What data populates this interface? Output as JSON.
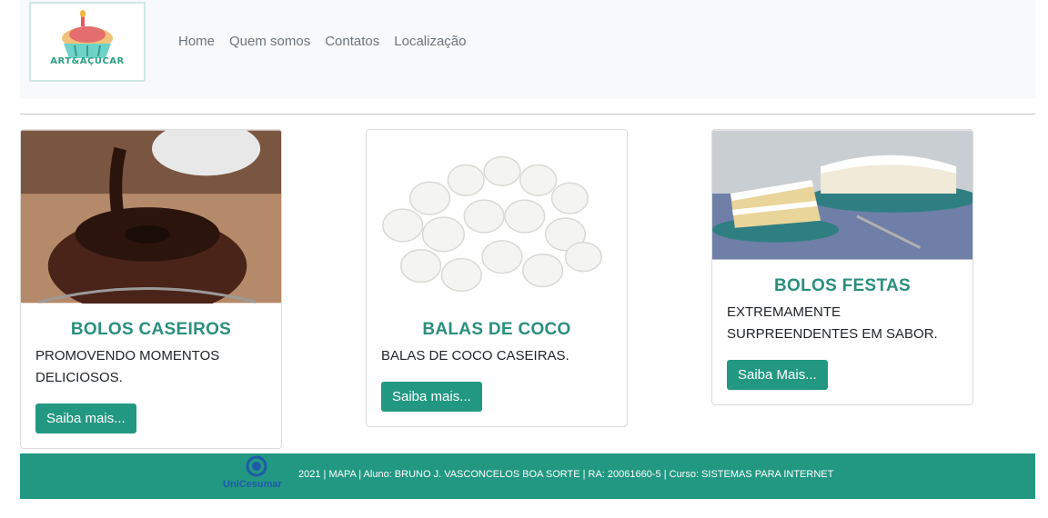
{
  "brand": {
    "logo_text": "ART&AÇUCAR"
  },
  "nav": {
    "items": [
      "Home",
      "Quem somos",
      "Contatos",
      "Localização"
    ]
  },
  "cards": [
    {
      "title": "BOLOS CASEIROS",
      "text": "PROMOVENDO MOMENTOS DELICIOSOS.",
      "button": "Saiba mais..."
    },
    {
      "title": "BALAS DE COCO",
      "text": "BALAS DE COCO CASEIRAS.",
      "button": "Saiba mais..."
    },
    {
      "title": "BOLOS FESTAS",
      "text": "EXTREMAMENTE SURPREENDENTES EM SABOR.",
      "button": "Saiba Mais..."
    }
  ],
  "footer": {
    "logo_text": "UniCesumar",
    "text": "2021 | MAPA | Aluno: BRUNO J. VASCONCELOS BOA SORTE | RA: 20061660-5 | Curso: SISTEMAS PARA INTERNET"
  },
  "colors": {
    "accent": "#229882",
    "title": "#2a8f7c",
    "navbar_bg": "#f8f9fa"
  }
}
